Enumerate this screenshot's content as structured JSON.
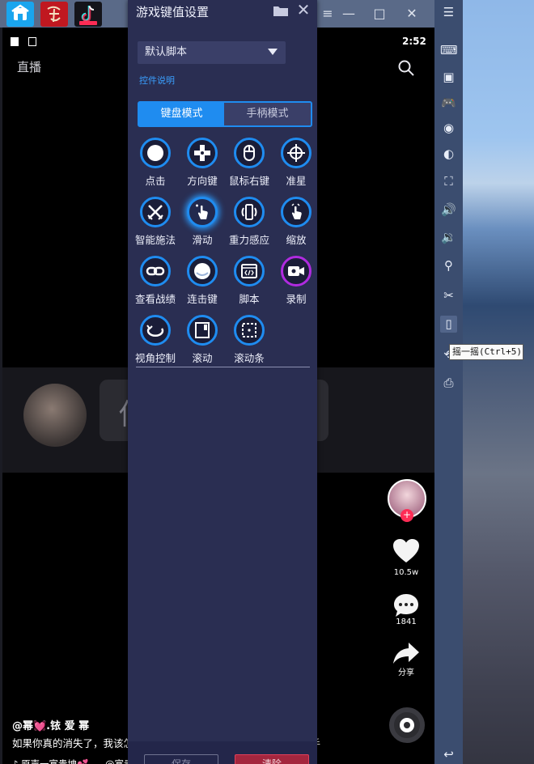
{
  "titlebar": {
    "app_tabs": [
      "home",
      "李白",
      "tiktok"
    ],
    "controls": [
      "—",
      "□",
      "✕"
    ]
  },
  "phone": {
    "status_time": "2:52",
    "top_left_label": "直播",
    "blurred_text": "你",
    "likes": "10.5w",
    "comments": "1841",
    "share": "分享",
    "caption_user": "@幂💓.铱 爱 幂",
    "caption_text": "如果你真的消失了，我该怎",
    "caption_suffix": "助手",
    "music_1": "♪ 原声一富贵坤💕",
    "music_2": "@富贵"
  },
  "panel": {
    "title": "游戏键值设置",
    "script_select": "默认脚本",
    "help_link": "控件说明",
    "tab_keyboard": "键盘模式",
    "tab_gamepad": "手柄模式",
    "controls": [
      {
        "label": "点击",
        "icon": "circle-icon"
      },
      {
        "label": "方向键",
        "icon": "dpad-icon"
      },
      {
        "label": "鼠标右键",
        "icon": "mouse-icon"
      },
      {
        "label": "准星",
        "icon": "crosshair-icon"
      },
      {
        "label": "智能施法",
        "icon": "swords-icon"
      },
      {
        "label": "滑动",
        "icon": "swipe-hand-icon"
      },
      {
        "label": "重力感应",
        "icon": "gravity-icon"
      },
      {
        "label": "缩放",
        "icon": "pinch-hand-icon"
      },
      {
        "label": "查看战绩",
        "icon": "link-icon"
      },
      {
        "label": "连击键",
        "icon": "combo-circle-icon"
      },
      {
        "label": "脚本",
        "icon": "script-icon"
      },
      {
        "label": "录制",
        "icon": "record-icon"
      },
      {
        "label": "视角控制",
        "icon": "rotate-view-icon"
      },
      {
        "label": "滚动",
        "icon": "scroll-icon"
      },
      {
        "label": "滚动条",
        "icon": "scrollbar-icon"
      }
    ],
    "reset_label": "保存",
    "clear_label": "清除"
  },
  "toolbar": {
    "tooltip": "摇一摇(Ctrl+5)"
  },
  "colors": {
    "accent": "#1f8cf0",
    "panel_bg": "#2a2e52",
    "toolbar_bg": "#3b4d6f",
    "record_ring": "#b02be0"
  }
}
